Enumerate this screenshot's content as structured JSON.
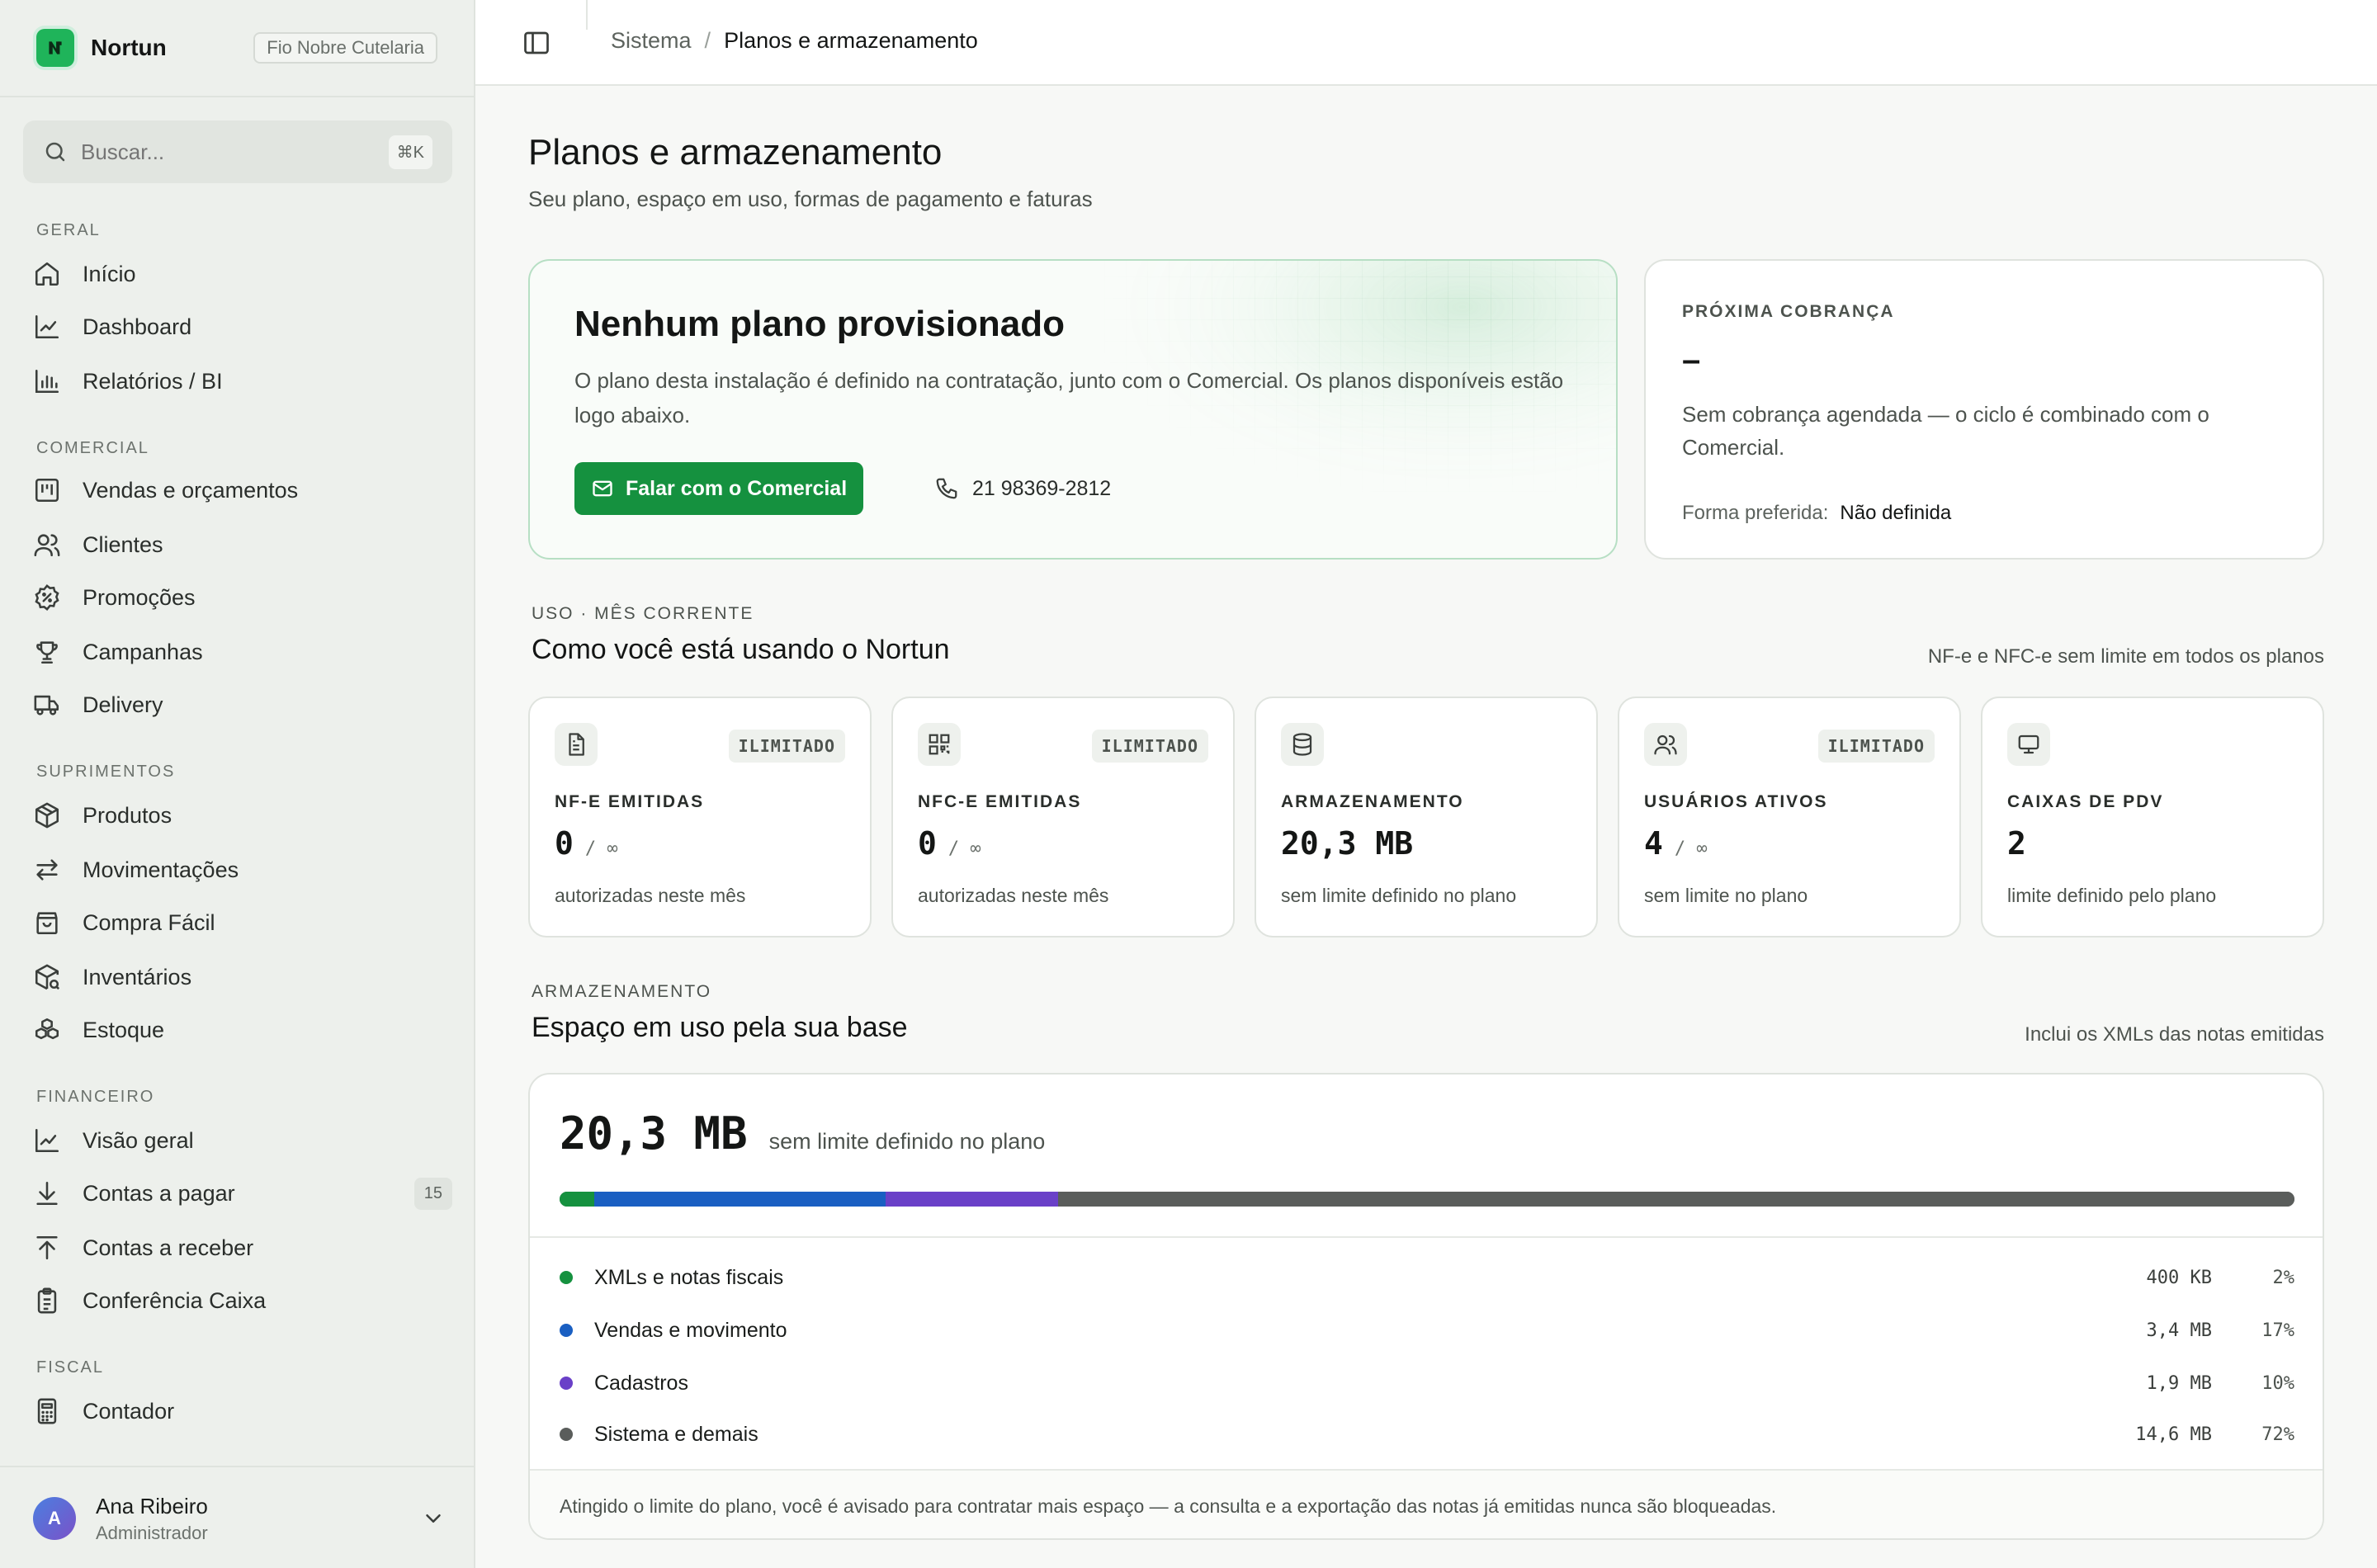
{
  "app": {
    "name": "Nortun",
    "org": "Fio Nobre Cutelaria"
  },
  "search": {
    "placeholder": "Buscar...",
    "shortcut": "⌘K"
  },
  "nav": {
    "geral": {
      "title": "GERAL",
      "items": [
        {
          "label": "Início",
          "icon": "home-icon"
        },
        {
          "label": "Dashboard",
          "icon": "chart-line-icon"
        },
        {
          "label": "Relatórios / BI",
          "icon": "bar-chart-icon"
        }
      ]
    },
    "comercial": {
      "title": "COMERCIAL",
      "items": [
        {
          "label": "Vendas e orçamentos",
          "icon": "kanban-icon"
        },
        {
          "label": "Clientes",
          "icon": "users-icon"
        },
        {
          "label": "Promoções",
          "icon": "badge-percent-icon"
        },
        {
          "label": "Campanhas",
          "icon": "trophy-icon"
        },
        {
          "label": "Delivery",
          "icon": "truck-icon"
        }
      ]
    },
    "suprimentos": {
      "title": "SUPRIMENTOS",
      "items": [
        {
          "label": "Produtos",
          "icon": "package-icon"
        },
        {
          "label": "Movimentações",
          "icon": "arrows-left-right-icon"
        },
        {
          "label": "Compra Fácil",
          "icon": "shopping-bag-icon"
        },
        {
          "label": "Inventários",
          "icon": "package-search-icon"
        },
        {
          "label": "Estoque",
          "icon": "boxes-icon"
        }
      ]
    },
    "financeiro": {
      "title": "FINANCEIRO",
      "items": [
        {
          "label": "Visão geral",
          "icon": "chart-line-icon"
        },
        {
          "label": "Contas a pagar",
          "icon": "arrow-down-icon",
          "count": "15"
        },
        {
          "label": "Contas a receber",
          "icon": "arrow-up-icon"
        },
        {
          "label": "Conferência Caixa",
          "icon": "clipboard-icon"
        }
      ]
    },
    "fiscal": {
      "title": "FISCAL",
      "items": [
        {
          "label": "Contador",
          "icon": "calculator-icon"
        }
      ]
    }
  },
  "user": {
    "initial": "A",
    "name": "Ana Ribeiro",
    "role": "Administrador"
  },
  "breadcrumb": {
    "parent": "Sistema",
    "separator": "/",
    "current": "Planos e armazenamento"
  },
  "page": {
    "title": "Planos e armazenamento",
    "subtitle": "Seu plano, espaço em uso, formas de pagamento e faturas"
  },
  "plan": {
    "title": "Nenhum plano provisionado",
    "description": "O plano desta instalação é definido na contratação, junto com o Comercial. Os planos disponíveis estão logo abaixo.",
    "cta": "Falar com o Comercial",
    "phone": "21 98369-2812"
  },
  "billing": {
    "eyebrow": "PRÓXIMA COBRANÇA",
    "amount": "–",
    "description": "Sem cobrança agendada — o ciclo é combinado com o Comercial.",
    "pref_label": "Forma preferida:",
    "pref_value": "Não definida"
  },
  "usage": {
    "eyebrow": "USO · MÊS CORRENTE",
    "title": "Como você está usando o Nortun",
    "note": "NF-e e NFC-e sem limite em todos os planos",
    "cards": [
      {
        "icon": "file-text-icon",
        "badge": "ILIMITADO",
        "label": "NF-E EMITIDAS",
        "value": "0",
        "limit": "/ ∞",
        "sub": "autorizadas neste mês"
      },
      {
        "icon": "qr-code-icon",
        "badge": "ILIMITADO",
        "label": "NFC-E EMITIDAS",
        "value": "0",
        "limit": "/ ∞",
        "sub": "autorizadas neste mês"
      },
      {
        "icon": "database-icon",
        "badge": "",
        "label": "ARMAZENAMENTO",
        "value": "20,3 MB",
        "limit": "",
        "sub": "sem limite definido no plano"
      },
      {
        "icon": "users-icon",
        "badge": "ILIMITADO",
        "label": "USUÁRIOS ATIVOS",
        "value": "4",
        "limit": "/ ∞",
        "sub": "sem limite no plano"
      },
      {
        "icon": "monitor-icon",
        "badge": "",
        "label": "CAIXAS DE PDV",
        "value": "2",
        "limit": "",
        "sub": "limite definido pelo plano"
      }
    ]
  },
  "storage": {
    "eyebrow": "ARMAZENAMENTO",
    "title": "Espaço em uso pela sua base",
    "note": "Inclui os XMLs das notas emitidas",
    "total": "20,3 MB",
    "total_sub": "sem limite definido no plano",
    "rows": [
      {
        "name": "XMLs e notas fiscais",
        "size": "400 KB",
        "pct": "2%",
        "fraction": 0.02,
        "color": "#15913f"
      },
      {
        "name": "Vendas e movimento",
        "size": "3,4 MB",
        "pct": "17%",
        "fraction": 0.17,
        "color": "#1a5fc2"
      },
      {
        "name": "Cadastros",
        "size": "1,9 MB",
        "pct": "10%",
        "fraction": 0.1,
        "color": "#6a40c8"
      },
      {
        "name": "Sistema e demais",
        "size": "14,6 MB",
        "pct": "72%",
        "fraction": 0.72,
        "color": "#5a5d5b"
      }
    ],
    "footer": "Atingido o limite do plano, você é avisado para contratar mais espaço — a consulta e a exportação das notas já emitidas nunca são bloqueadas."
  }
}
